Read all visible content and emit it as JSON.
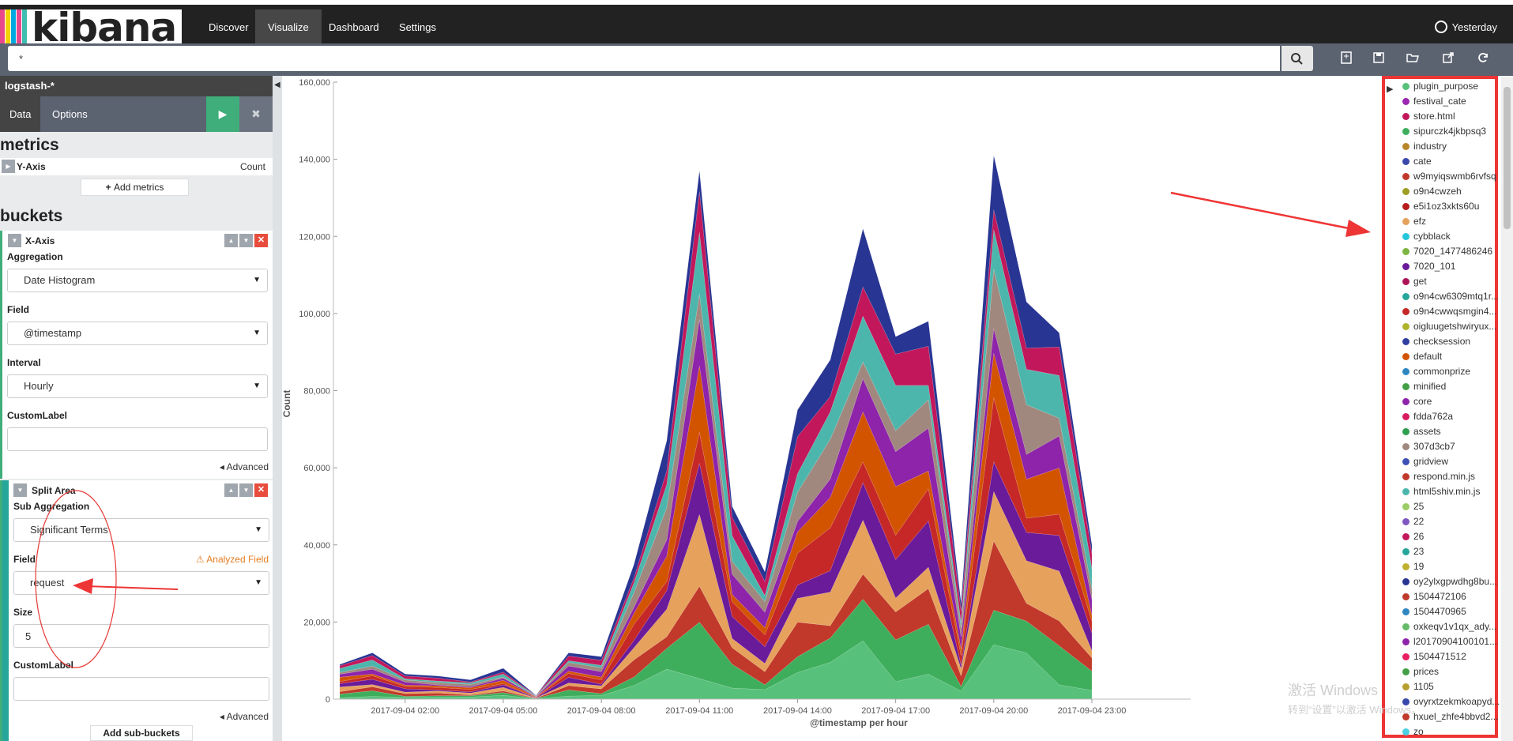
{
  "app": {
    "logo_text": "kibana"
  },
  "nav": {
    "items": [
      "Discover",
      "Visualize",
      "Dashboard",
      "Settings"
    ],
    "active": "Visualize",
    "time": "Yesterday"
  },
  "search": {
    "query": "*"
  },
  "sidebar": {
    "index_pattern": "logstash-*",
    "tabs": [
      "Data",
      "Options"
    ],
    "metrics_title": "metrics",
    "y_axis_label": "Y-Axis",
    "y_axis_value": "Count",
    "add_metrics": "Add metrics",
    "buckets_title": "buckets",
    "x_axis": {
      "label": "X-Axis",
      "aggregation_label": "Aggregation",
      "aggregation": "Date Histogram",
      "field_label": "Field",
      "field": "@timestamp",
      "interval_label": "Interval",
      "interval": "Hourly",
      "custom_label": "CustomLabel",
      "advanced": "Advanced"
    },
    "split_area": {
      "label": "Split Area",
      "sub_aggregation_label": "Sub Aggregation",
      "sub_aggregation": "Significant Terms",
      "field_label": "Field",
      "analyzed_field": "Analyzed Field",
      "field": "request",
      "size_label": "Size",
      "size": "5",
      "custom_label": "CustomLabel",
      "advanced": "Advanced"
    },
    "add_sub_buckets": "Add sub-buckets"
  },
  "chart_data": {
    "type": "area",
    "stacked": true,
    "xlabel": "@timestamp per hour",
    "ylabel": "Count",
    "ylim": [
      0,
      160000
    ],
    "y_ticks": [
      "0",
      "20,000",
      "40,000",
      "60,000",
      "80,000",
      "100,000",
      "120,000",
      "140,000",
      "160,000"
    ],
    "x_ticks": [
      "2017-09-04 02:00",
      "2017-09-04 05:00",
      "2017-09-04 08:00",
      "2017-09-04 11:00",
      "2017-09-04 14:00",
      "2017-09-04 17:00",
      "2017-09-04 20:00",
      "2017-09-04 23:00"
    ],
    "x_hours": [
      0,
      1,
      2,
      3,
      4,
      5,
      6,
      7,
      8,
      9,
      10,
      11,
      12,
      13,
      14,
      15,
      16,
      17,
      18,
      19,
      20,
      21,
      22,
      23
    ],
    "totals": [
      9000,
      12000,
      6500,
      6000,
      5000,
      8000,
      1000,
      12000,
      11000,
      35000,
      67000,
      137000,
      50000,
      33000,
      75000,
      88000,
      122000,
      94000,
      98000,
      25000,
      141000,
      103000,
      95000,
      40000
    ]
  },
  "legend": {
    "items": [
      {
        "label": "plugin_purpose",
        "color": "#57c17b"
      },
      {
        "label": "festival_cate",
        "color": "#9c27b0"
      },
      {
        "label": "store.html",
        "color": "#c2185b"
      },
      {
        "label": "sipurczk4jkbpsq3",
        "color": "#3fae5c"
      },
      {
        "label": "industry",
        "color": "#b8862a"
      },
      {
        "label": "cate",
        "color": "#3949ab"
      },
      {
        "label": "w9myiqswmb6rvfsq",
        "color": "#c0392b"
      },
      {
        "label": "o9n4cwzeh",
        "color": "#9e9d24"
      },
      {
        "label": "e5i1oz3xkts60u",
        "color": "#b71c1c"
      },
      {
        "label": "efz",
        "color": "#e6a15c"
      },
      {
        "label": "cybblack",
        "color": "#26c6da"
      },
      {
        "label": "7020_1477486246",
        "color": "#7cb342"
      },
      {
        "label": "7020_101",
        "color": "#6a1b9a"
      },
      {
        "label": "get",
        "color": "#ad1457"
      },
      {
        "label": "o9n4cw6309mtq1r...",
        "color": "#26a69a"
      },
      {
        "label": "o9n4cwwqsmgin4...",
        "color": "#c62828"
      },
      {
        "label": "oigluugetshwiryux...",
        "color": "#afb42b"
      },
      {
        "label": "checksession",
        "color": "#303f9f"
      },
      {
        "label": "default",
        "color": "#d35400"
      },
      {
        "label": "commonprize",
        "color": "#2e86c1"
      },
      {
        "label": "minified",
        "color": "#43a047"
      },
      {
        "label": "core",
        "color": "#8e24aa"
      },
      {
        "label": "fdda762a",
        "color": "#d81b60"
      },
      {
        "label": "assets",
        "color": "#2e9e4f"
      },
      {
        "label": "307d3cb7",
        "color": "#a1887f"
      },
      {
        "label": "gridview",
        "color": "#3f51b5"
      },
      {
        "label": "respond.min.js",
        "color": "#c0392b"
      },
      {
        "label": "html5shiv.min.js",
        "color": "#4db6ac"
      },
      {
        "label": "25",
        "color": "#9ccc65"
      },
      {
        "label": "22",
        "color": "#7e57c2"
      },
      {
        "label": "26",
        "color": "#c2185b"
      },
      {
        "label": "23",
        "color": "#26a69a"
      },
      {
        "label": "19",
        "color": "#c0b030"
      },
      {
        "label": "oy2ylxgpwdhg8bu...",
        "color": "#283593"
      },
      {
        "label": "1504472106",
        "color": "#c0392b"
      },
      {
        "label": "1504470965",
        "color": "#2e86c1"
      },
      {
        "label": "oxkeqv1v1qx_ady...",
        "color": "#66bb6a"
      },
      {
        "label": "l20170904100101...",
        "color": "#8e24aa"
      },
      {
        "label": "1504471512",
        "color": "#e91e63"
      },
      {
        "label": "prices",
        "color": "#43a047"
      },
      {
        "label": "1105",
        "color": "#b8a030"
      },
      {
        "label": "ovyrxtzekmkoapyd...",
        "color": "#3949ab"
      },
      {
        "label": "hxuel_zhfe4bbvd2...",
        "color": "#c0392b"
      },
      {
        "label": "zo",
        "color": "#4dd0e1"
      }
    ]
  },
  "watermark": {
    "line1": "激活 Windows",
    "line2": "转到“设置”以激活 Windows。"
  },
  "colors": {
    "nav_bg": "#222222",
    "nav_active": "#474747",
    "search_bg": "#5b6270",
    "play": "#3fae7b",
    "legend_border": "#ee3535"
  }
}
